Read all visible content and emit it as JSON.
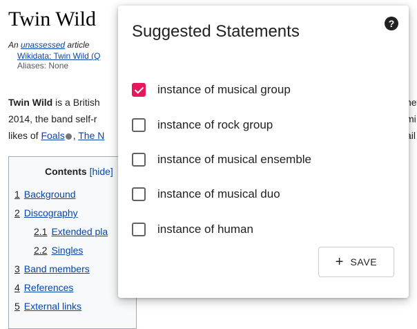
{
  "article": {
    "title": "Twin Wild",
    "meta_prefix": "An ",
    "meta_link": "unassessed",
    "meta_suffix": " article",
    "wikidata_link": "Wikidata: Twin Wild",
    "wikidata_paren": " (Q",
    "aliases": "Aliases: None",
    "para1_bold": "Twin Wild",
    "para1_rest": " is a British",
    "para2": "2014, the band self-r",
    "para3_prefix": "likes of ",
    "para3_link1": "Foals",
    "para3_sep": ", ",
    "para3_link2": "The N",
    "clip1": "he",
    "clip2": "mi",
    "clip3": "ail"
  },
  "toc": {
    "title": "Contents",
    "hide_label": "[hide]",
    "items": [
      {
        "num": "1",
        "label": "Background"
      },
      {
        "num": "2",
        "label": "Discography"
      },
      {
        "num": "2.1",
        "label": "Extended pla"
      },
      {
        "num": "2.2",
        "label": "Singles"
      },
      {
        "num": "3",
        "label": "Band members"
      },
      {
        "num": "4",
        "label": "References"
      },
      {
        "num": "5",
        "label": "External links"
      }
    ]
  },
  "dialog": {
    "title": "Suggested Statements",
    "help_icon": "question-circle-icon",
    "help_glyph": "?",
    "accent_color": "#e8175d",
    "options": [
      {
        "label": "instance of musical group",
        "checked": true
      },
      {
        "label": "instance of rock group",
        "checked": false
      },
      {
        "label": "instance of musical ensemble",
        "checked": false
      },
      {
        "label": "instance of musical duo",
        "checked": false
      },
      {
        "label": "instance of human",
        "checked": false
      }
    ],
    "save_icon": "plus-icon",
    "save_glyph": "+",
    "save_label": "SAVE"
  }
}
